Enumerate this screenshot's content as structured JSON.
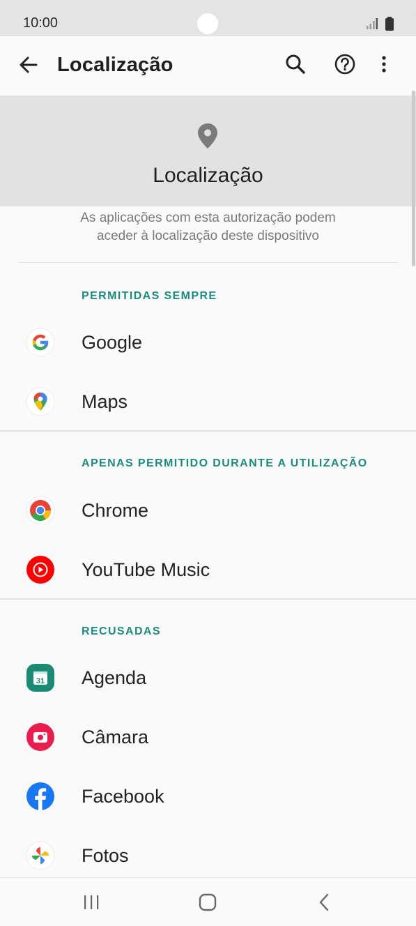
{
  "status_bar": {
    "time": "10:00"
  },
  "app_bar": {
    "title": "Localização",
    "icons": [
      "back-arrow-icon",
      "search-icon",
      "help-icon",
      "more-vert-icon"
    ]
  },
  "header": {
    "icon": "location-pin-icon",
    "title": "Localização",
    "description_line1": "As aplicações com esta autorização podem",
    "description_line2": "aceder à localização deste dispositivo"
  },
  "sections": [
    {
      "label": "PERMITIDAS SEMPRE",
      "apps": [
        {
          "name": "Google",
          "icon": "google-icon"
        },
        {
          "name": "Maps",
          "icon": "maps-icon"
        }
      ]
    },
    {
      "label": "APENAS PERMITIDO DURANTE A UTILIZAÇÃO",
      "apps": [
        {
          "name": "Chrome",
          "icon": "chrome-icon"
        },
        {
          "name": "YouTube Music",
          "icon": "youtube-music-icon"
        }
      ]
    },
    {
      "label": "RECUSADAS",
      "apps": [
        {
          "name": "Agenda",
          "icon": "calendar-icon",
          "badge": "31"
        },
        {
          "name": "Câmara",
          "icon": "camera-icon"
        },
        {
          "name": "Facebook",
          "icon": "facebook-icon"
        },
        {
          "name": "Fotos",
          "icon": "photos-icon"
        }
      ]
    }
  ],
  "colors": {
    "accent": "#1d8a7e",
    "header_bg": "#e2e2e2",
    "page_bg": "#fafafa"
  },
  "nav_bar": {
    "icons": [
      "recents-icon",
      "home-icon",
      "back-icon"
    ]
  }
}
